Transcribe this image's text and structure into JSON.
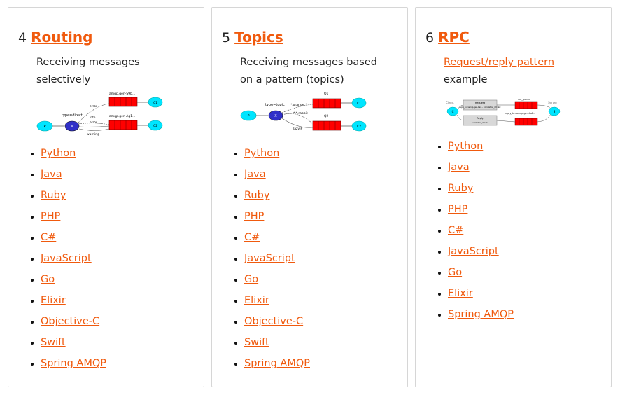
{
  "cards": [
    {
      "number": "4",
      "title": "Routing",
      "desc": "Receiving messages selectively",
      "diagram": {
        "producer": "P",
        "exchange": "X",
        "consumer1": "C1",
        "consumer2": "C2",
        "queue1": "amqp.gen-S9b...",
        "queue2": "amqp.gen-Ag1...",
        "exchange_type": "type=direct",
        "binding_error": "error",
        "binding_info": "info",
        "binding_error2": "error",
        "binding_warning": "warning"
      },
      "links": [
        "Python",
        "Java",
        "Ruby",
        "PHP",
        "C#",
        "JavaScript",
        "Go",
        "Elixir",
        "Objective-C",
        "Swift",
        "Spring AMQP"
      ]
    },
    {
      "number": "5",
      "title": "Topics",
      "desc": "Receiving messages based on a pattern (topics)",
      "diagram": {
        "producer": "P",
        "exchange": "X",
        "consumer1": "C1",
        "consumer2": "C2",
        "queue1": "Q1",
        "queue2": "Q2",
        "exchange_type": "type=topic",
        "binding1": "*.orange.*",
        "binding2": "*.*.rabbit",
        "binding3": "lazy.#"
      },
      "links": [
        "Python",
        "Java",
        "Ruby",
        "PHP",
        "C#",
        "JavaScript",
        "Go",
        "Elixir",
        "Objective-C",
        "Swift",
        "Spring AMQP"
      ]
    },
    {
      "number": "6",
      "title": "RPC",
      "desc_link": "Request/reply pattern",
      "desc_rest": "example",
      "diagram": {
        "client": "Client",
        "server": "Server",
        "client_node": "C",
        "server_node": "S",
        "rpc_queue": "rpc_queue",
        "reply_queue": "reply_to=amqp.gen-Xa2...",
        "request_box": "Request",
        "request_detail": "reply_to=amqp.gen-Xa2... correlation_id=abc",
        "reply_box": "Reply",
        "reply_detail": "correlation_id=abc"
      },
      "links": [
        "Python",
        "Java",
        "Ruby",
        "PHP",
        "C#",
        "JavaScript",
        "Go",
        "Elixir",
        "Spring AMQP"
      ]
    }
  ],
  "colors": {
    "link": "#f05a0e",
    "queue_red": "#ff0000",
    "node_cyan": "#00e5ff",
    "exchange_blue": "#3030c8"
  }
}
